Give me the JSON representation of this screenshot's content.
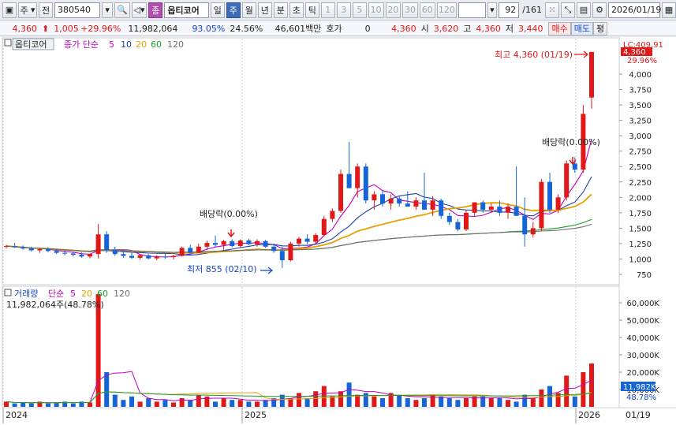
{
  "toolbar": {
    "market": "주",
    "range": "전",
    "code": "380540",
    "stock_name": "옵티코어",
    "stock_tag": "종",
    "periods": [
      "일",
      "주",
      "월",
      "년",
      "분",
      "초",
      "틱"
    ],
    "active_period": "주",
    "intervals": [
      "1",
      "3",
      "5",
      "10",
      "20",
      "30",
      "60",
      "120"
    ],
    "count": "92",
    "total": "/161",
    "date": "2026/01/19"
  },
  "quote": {
    "price": "4,360",
    "change": "1,005",
    "change_rate": "+29.96%",
    "volume": "11,982,064",
    "vol_ratio": "93.05%",
    "turnover_rate": "24.56%",
    "amount": "46,601백만",
    "hoga_label": "호가",
    "hoga": "0",
    "hoga_price": "4,360",
    "open_label": "시",
    "open": "3,620",
    "high_label": "고",
    "high": "4,360",
    "low_label": "저",
    "low": "3,440",
    "buy": "매수",
    "sell": "매도",
    "extra": "평"
  },
  "legend": {
    "name": "옵티코어",
    "ma_title": "종가 단순",
    "ma": [
      "5",
      "10",
      "20",
      "60",
      "120"
    ]
  },
  "vol_legend": {
    "title": "거래량",
    "ma_title": "단순",
    "ma": [
      "5",
      "20",
      "60",
      "120"
    ],
    "current": "11,982,064주(48.78%)"
  },
  "annotations": {
    "high": "최고 4,360 (01/19)",
    "low": "최저 855 (02/10)",
    "div1": "배당락(0.00%)",
    "div2": "배당락(0.00%)"
  },
  "price_axis": {
    "top_label": "LC:409.91",
    "cur_price": "4,360",
    "cur_rate": "29.96%",
    "ticks": [
      "4,000",
      "3,750",
      "3,500",
      "3,250",
      "3,000",
      "2,750",
      "2,500",
      "2,250",
      "2,000",
      "1,750",
      "1,500",
      "1,250",
      "1,000",
      "750"
    ]
  },
  "vol_axis": {
    "ticks": [
      "60,000K",
      "50,000K",
      "40,000K",
      "30,000K",
      "20,000K",
      "10,000K"
    ],
    "cur_vol": "11,982K",
    "cur_rate": "48.78%"
  },
  "x_axis": {
    "labels": [
      "2024",
      "2025",
      "2026"
    ],
    "end_date": "01/19"
  },
  "colors": {
    "up": "#e01818",
    "down": "#1565d8",
    "ma5": "#c000c0",
    "ma10": "#1d3fa8",
    "ma20": "#e8a000",
    "ma60": "#1a9a2a",
    "ma120": "#707070"
  },
  "chart_data": {
    "type": "candlestick",
    "ohlc": [
      [
        1200,
        1230,
        1170,
        1210
      ],
      [
        1210,
        1260,
        1180,
        1190
      ],
      [
        1190,
        1220,
        1150,
        1170
      ],
      [
        1170,
        1200,
        1120,
        1140
      ],
      [
        1140,
        1180,
        1100,
        1160
      ],
      [
        1160,
        1190,
        1110,
        1130
      ],
      [
        1130,
        1160,
        1080,
        1100
      ],
      [
        1100,
        1140,
        1060,
        1090
      ],
      [
        1090,
        1120,
        1040,
        1070
      ],
      [
        1070,
        1110,
        1020,
        1040
      ],
      [
        1040,
        1090,
        1010,
        1080
      ],
      [
        1080,
        1570,
        1010,
        1400
      ],
      [
        1400,
        1450,
        1100,
        1150
      ],
      [
        1150,
        1200,
        1050,
        1080
      ],
      [
        1080,
        1120,
        1020,
        1050
      ],
      [
        1050,
        1100,
        1000,
        1020
      ],
      [
        1020,
        1080,
        990,
        1060
      ],
      [
        1060,
        1080,
        990,
        1010
      ],
      [
        1010,
        1060,
        980,
        1040
      ],
      [
        1040,
        1080,
        1000,
        1030
      ],
      [
        1030,
        1070,
        990,
        1050
      ],
      [
        1050,
        1200,
        1040,
        1180
      ],
      [
        1180,
        1230,
        1080,
        1100
      ],
      [
        1100,
        1250,
        1090,
        1200
      ],
      [
        1200,
        1300,
        1150,
        1260
      ],
      [
        1260,
        1380,
        1200,
        1230
      ],
      [
        1230,
        1310,
        1150,
        1290
      ],
      [
        1290,
        1320,
        1190,
        1210
      ],
      [
        1210,
        1320,
        1190,
        1300
      ],
      [
        1300,
        1330,
        1220,
        1240
      ],
      [
        1240,
        1320,
        1200,
        1290
      ],
      [
        1290,
        1310,
        1180,
        1200
      ],
      [
        1200,
        1250,
        1100,
        1130
      ],
      [
        1130,
        1200,
        855,
        980
      ],
      [
        980,
        1280,
        960,
        1250
      ],
      [
        1250,
        1360,
        1200,
        1330
      ],
      [
        1330,
        1400,
        1240,
        1280
      ],
      [
        1280,
        1420,
        1250,
        1390
      ],
      [
        1390,
        1700,
        1370,
        1650
      ],
      [
        1650,
        1820,
        1600,
        1780
      ],
      [
        1780,
        2450,
        1750,
        2380
      ],
      [
        2380,
        2900,
        2150,
        2150
      ],
      [
        2150,
        2550,
        2000,
        2500
      ],
      [
        2500,
        2550,
        1900,
        1950
      ],
      [
        1950,
        2100,
        1800,
        2050
      ],
      [
        2050,
        2100,
        1850,
        1900
      ],
      [
        1900,
        2050,
        1800,
        1980
      ],
      [
        1980,
        2030,
        1850,
        1900
      ],
      [
        1900,
        2100,
        1850,
        1850
      ],
      [
        1850,
        2000,
        1800,
        1950
      ],
      [
        1950,
        2400,
        1800,
        1800
      ],
      [
        1800,
        2020,
        1700,
        1950
      ],
      [
        1950,
        1980,
        1650,
        1700
      ],
      [
        1700,
        1750,
        1550,
        1600
      ],
      [
        1600,
        1650,
        1450,
        1480
      ],
      [
        1480,
        1800,
        1450,
        1750
      ],
      [
        1750,
        1900,
        1700,
        1920
      ],
      [
        1920,
        1950,
        1750,
        1800
      ],
      [
        1800,
        1900,
        1750,
        1850
      ],
      [
        1850,
        1950,
        1700,
        1750
      ],
      [
        1750,
        1900,
        1650,
        1850
      ],
      [
        1850,
        2500,
        1700,
        1700
      ],
      [
        1700,
        2000,
        1200,
        1400
      ],
      [
        1400,
        1600,
        1350,
        1500
      ],
      [
        1500,
        2300,
        1450,
        2250
      ],
      [
        2250,
        2400,
        1750,
        1800
      ],
      [
        1800,
        2050,
        1750,
        2000
      ],
      [
        2000,
        2600,
        1950,
        2550
      ],
      [
        2550,
        2650,
        2400,
        2450
      ],
      [
        2450,
        3500,
        2400,
        3355
      ],
      [
        3620,
        4360,
        3440,
        4360
      ]
    ],
    "volume_k": [
      3,
      2,
      2.5,
      2,
      3,
      2,
      2.5,
      3,
      2,
      3,
      2.5,
      65,
      20,
      7,
      4,
      6,
      3,
      5,
      3,
      4,
      2.5,
      5,
      4,
      7,
      6,
      3,
      5,
      4,
      4,
      3,
      3,
      4,
      5,
      7,
      5,
      8,
      5,
      9,
      12,
      6,
      9,
      14,
      7,
      8,
      6,
      5,
      8,
      7,
      5,
      4,
      5,
      7,
      6,
      5,
      4,
      5,
      6,
      6,
      5,
      5,
      4,
      3,
      7,
      5,
      10,
      12,
      8,
      18,
      6,
      20,
      25
    ],
    "ma": {
      "5": "magenta",
      "10": "navy",
      "20": "orange",
      "60": "green",
      "120": "gray"
    }
  }
}
